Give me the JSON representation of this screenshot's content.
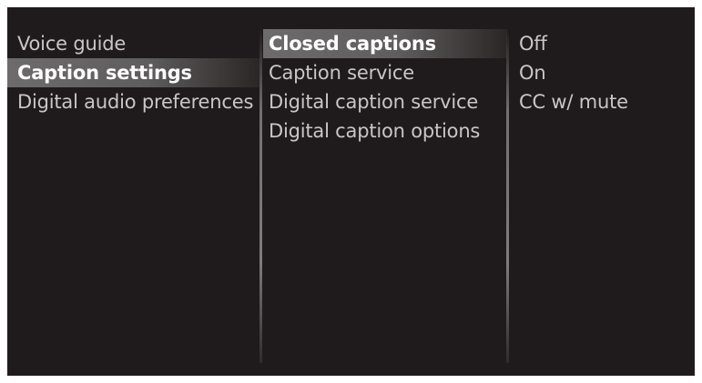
{
  "menu": {
    "level1": [
      {
        "label": "Voice guide"
      },
      {
        "label": "Caption settings"
      },
      {
        "label": "Digital audio preferences"
      }
    ],
    "level2": [
      {
        "label": "Closed captions"
      },
      {
        "label": "Caption service"
      },
      {
        "label": "Digital caption service"
      },
      {
        "label": "Digital caption options"
      }
    ],
    "level3": [
      {
        "label": "Off"
      },
      {
        "label": "On"
      },
      {
        "label": "CC w/ mute"
      }
    ]
  },
  "colors": {
    "background": "#1f1b1c",
    "text": "#c9c6c6",
    "selected_text": "#ffffff",
    "highlight": "#6d6b6b"
  }
}
